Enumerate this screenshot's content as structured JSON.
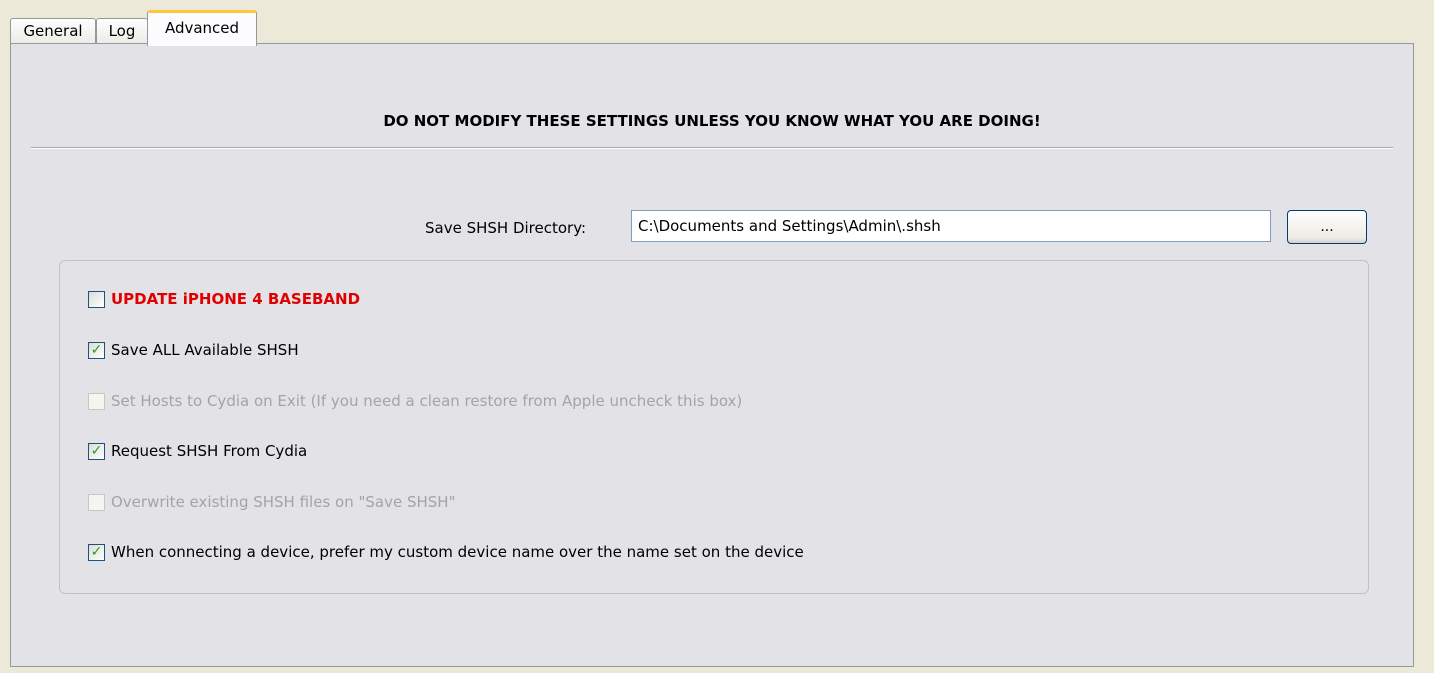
{
  "tabs": [
    {
      "label": "General",
      "active": false
    },
    {
      "label": "Log",
      "active": false
    },
    {
      "label": "Advanced",
      "active": true
    }
  ],
  "advanced": {
    "warning": "DO NOT MODIFY THESE SETTINGS UNLESS YOU KNOW WHAT YOU ARE DOING!",
    "save_dir_label": "Save SHSH Directory:",
    "save_dir_value": "C:\\Documents and Settings\\Admin\\.shsh",
    "browse_label": "...",
    "options": [
      {
        "label": "UPDATE iPHONE 4 BASEBAND",
        "checked": false,
        "enabled": true,
        "style": "warning-red"
      },
      {
        "label": "Save ALL Available SHSH",
        "checked": true,
        "enabled": true
      },
      {
        "label": "Set Hosts to Cydia on Exit (If you need a clean restore from Apple uncheck this box)",
        "checked": false,
        "enabled": false
      },
      {
        "label": "Request SHSH From Cydia",
        "checked": true,
        "enabled": true
      },
      {
        "label": "Overwrite existing SHSH files on \"Save SHSH\"",
        "checked": false,
        "enabled": false
      },
      {
        "label": "When connecting a device, prefer my custom device name over the name set on the device",
        "checked": true,
        "enabled": true
      }
    ]
  },
  "colors": {
    "warning_red": "#e00000",
    "checkmark_green": "#21a121",
    "active_tab_accent": "#ffc83c"
  }
}
